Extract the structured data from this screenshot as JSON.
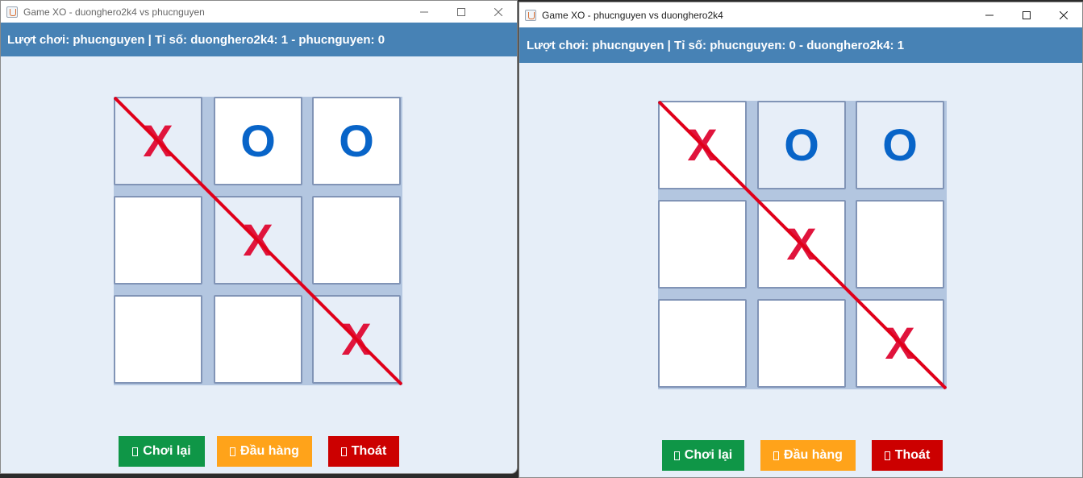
{
  "windows": [
    {
      "title": "Game XO - duonghero2k4 vs phucnguyen",
      "status": "Lượt chơi: phucnguyen | Tỉ số: duonghero2k4: 1 - phucnguyen: 0",
      "board": [
        "X",
        "O",
        "O",
        "",
        "X",
        "",
        "",
        "",
        "X"
      ],
      "shaded": [
        0,
        4,
        8
      ],
      "buttons": {
        "play_again": "Chơi lại",
        "surrender": "Đầu hàng",
        "exit": "Thoát"
      }
    },
    {
      "title": "Game XO - phucnguyen vs duonghero2k4",
      "status": "Lượt chơi: phucnguyen | Tỉ số: phucnguyen: 0 - duonghero2k4: 1",
      "board": [
        "X",
        "O",
        "O",
        "",
        "X",
        "",
        "",
        "",
        "X"
      ],
      "shaded": [
        1,
        2
      ],
      "buttons": {
        "play_again": "Chơi lại",
        "surrender": "Đầu hàng",
        "exit": "Thoát"
      }
    }
  ],
  "icons": {
    "app": "java-icon",
    "minimize": "minimize-icon",
    "maximize": "maximize-icon",
    "close": "close-icon",
    "button_glyph": "missing-glyph-icon"
  },
  "colors": {
    "status_bar": "#4782b5",
    "x_mark": "#e0143c",
    "o_mark": "#0864c8",
    "win_line": "#e0001a",
    "play_again": "#0f9647",
    "surrender": "#ffa31a",
    "exit": "#cc0000"
  }
}
